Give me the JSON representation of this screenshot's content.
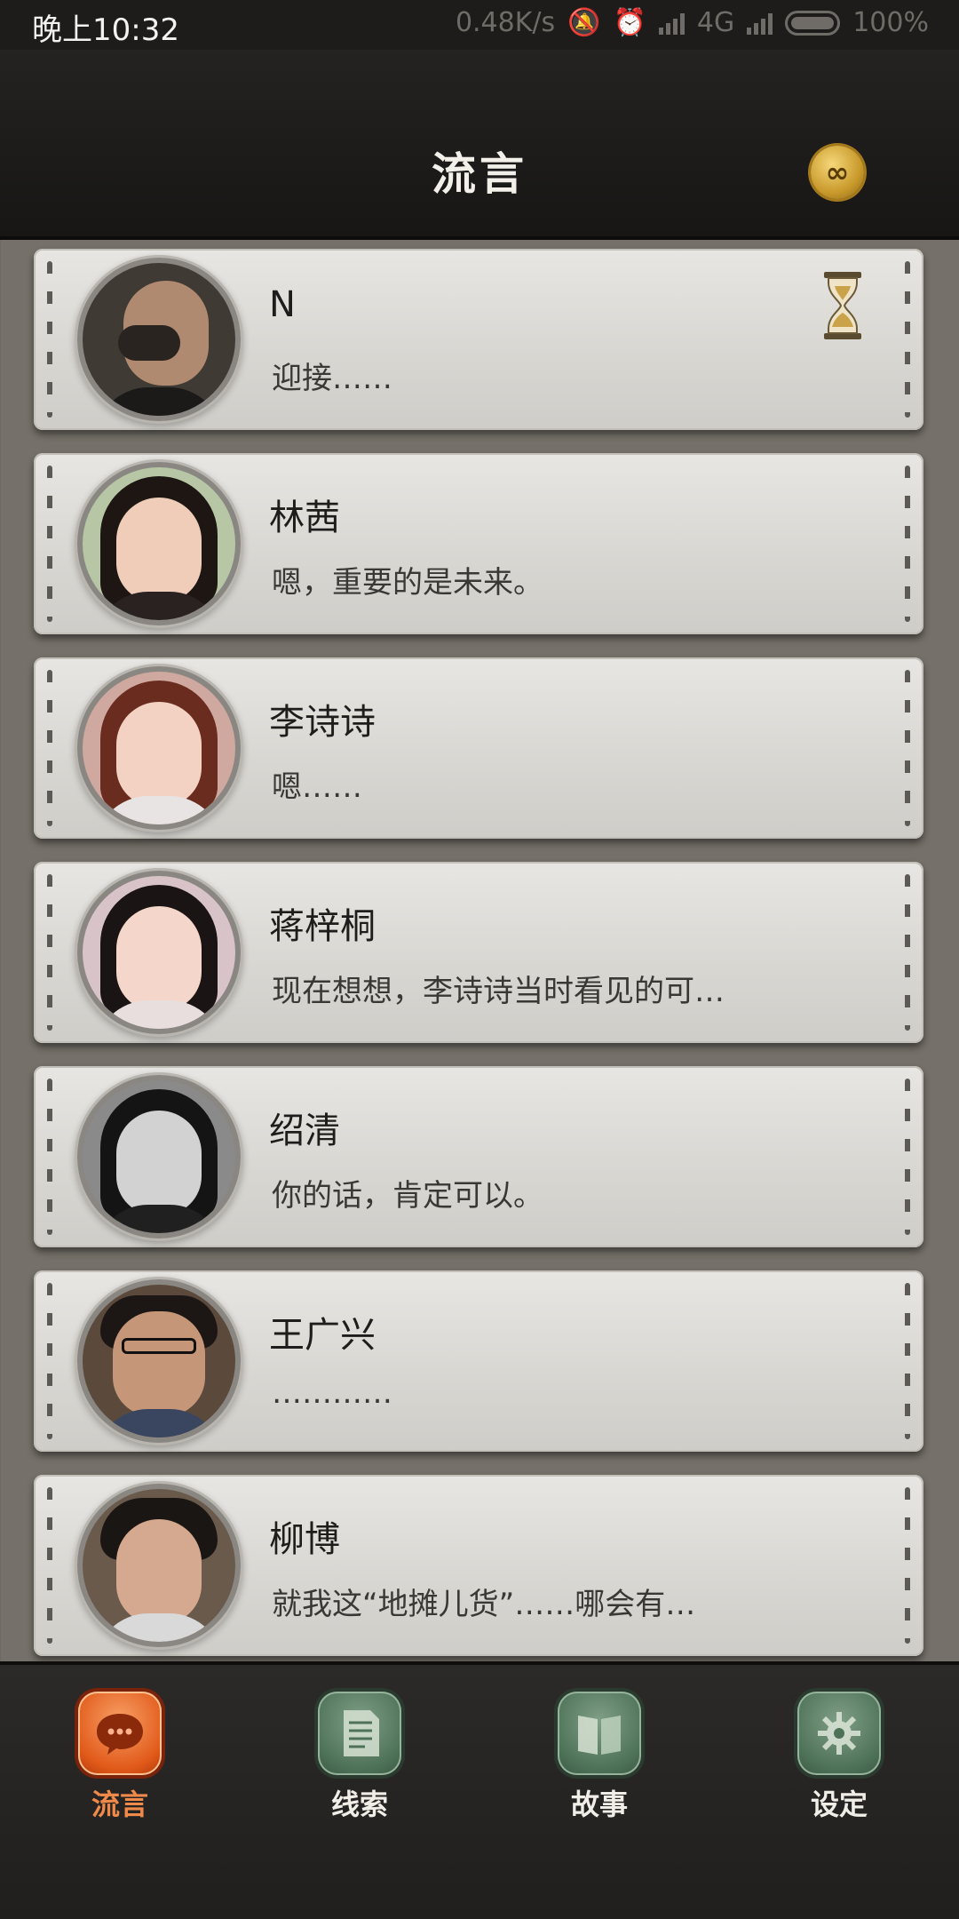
{
  "status_bar": {
    "time": "晚上10:32",
    "net_speed": "0.48K/s",
    "network": "4G",
    "battery": "100%"
  },
  "header": {
    "title": "流言"
  },
  "messages": [
    {
      "name": "N",
      "preview": "迎接……",
      "has_timer": true
    },
    {
      "name": "林茜",
      "preview": "嗯，重要的是未来。"
    },
    {
      "name": "李诗诗",
      "preview": "嗯……"
    },
    {
      "name": "蒋梓桐",
      "preview": "现在想想，李诗诗当时看见的可…"
    },
    {
      "name": "绍清",
      "preview": "你的话，肯定可以。"
    },
    {
      "name": "王广兴",
      "preview": "…………"
    },
    {
      "name": "柳博",
      "preview": "就我这“地摊儿货”……哪会有…"
    }
  ],
  "nav": {
    "items": [
      {
        "label": "流言",
        "icon": "chat-bubble-icon",
        "active": true
      },
      {
        "label": "线索",
        "icon": "document-icon",
        "active": false
      },
      {
        "label": "故事",
        "icon": "book-icon",
        "active": false
      },
      {
        "label": "设定",
        "icon": "gear-icon",
        "active": false
      }
    ]
  },
  "colors": {
    "active_accent": "#e15a1a",
    "nav_inactive": "#4e7258",
    "header_bg": "#1e1c1b"
  }
}
